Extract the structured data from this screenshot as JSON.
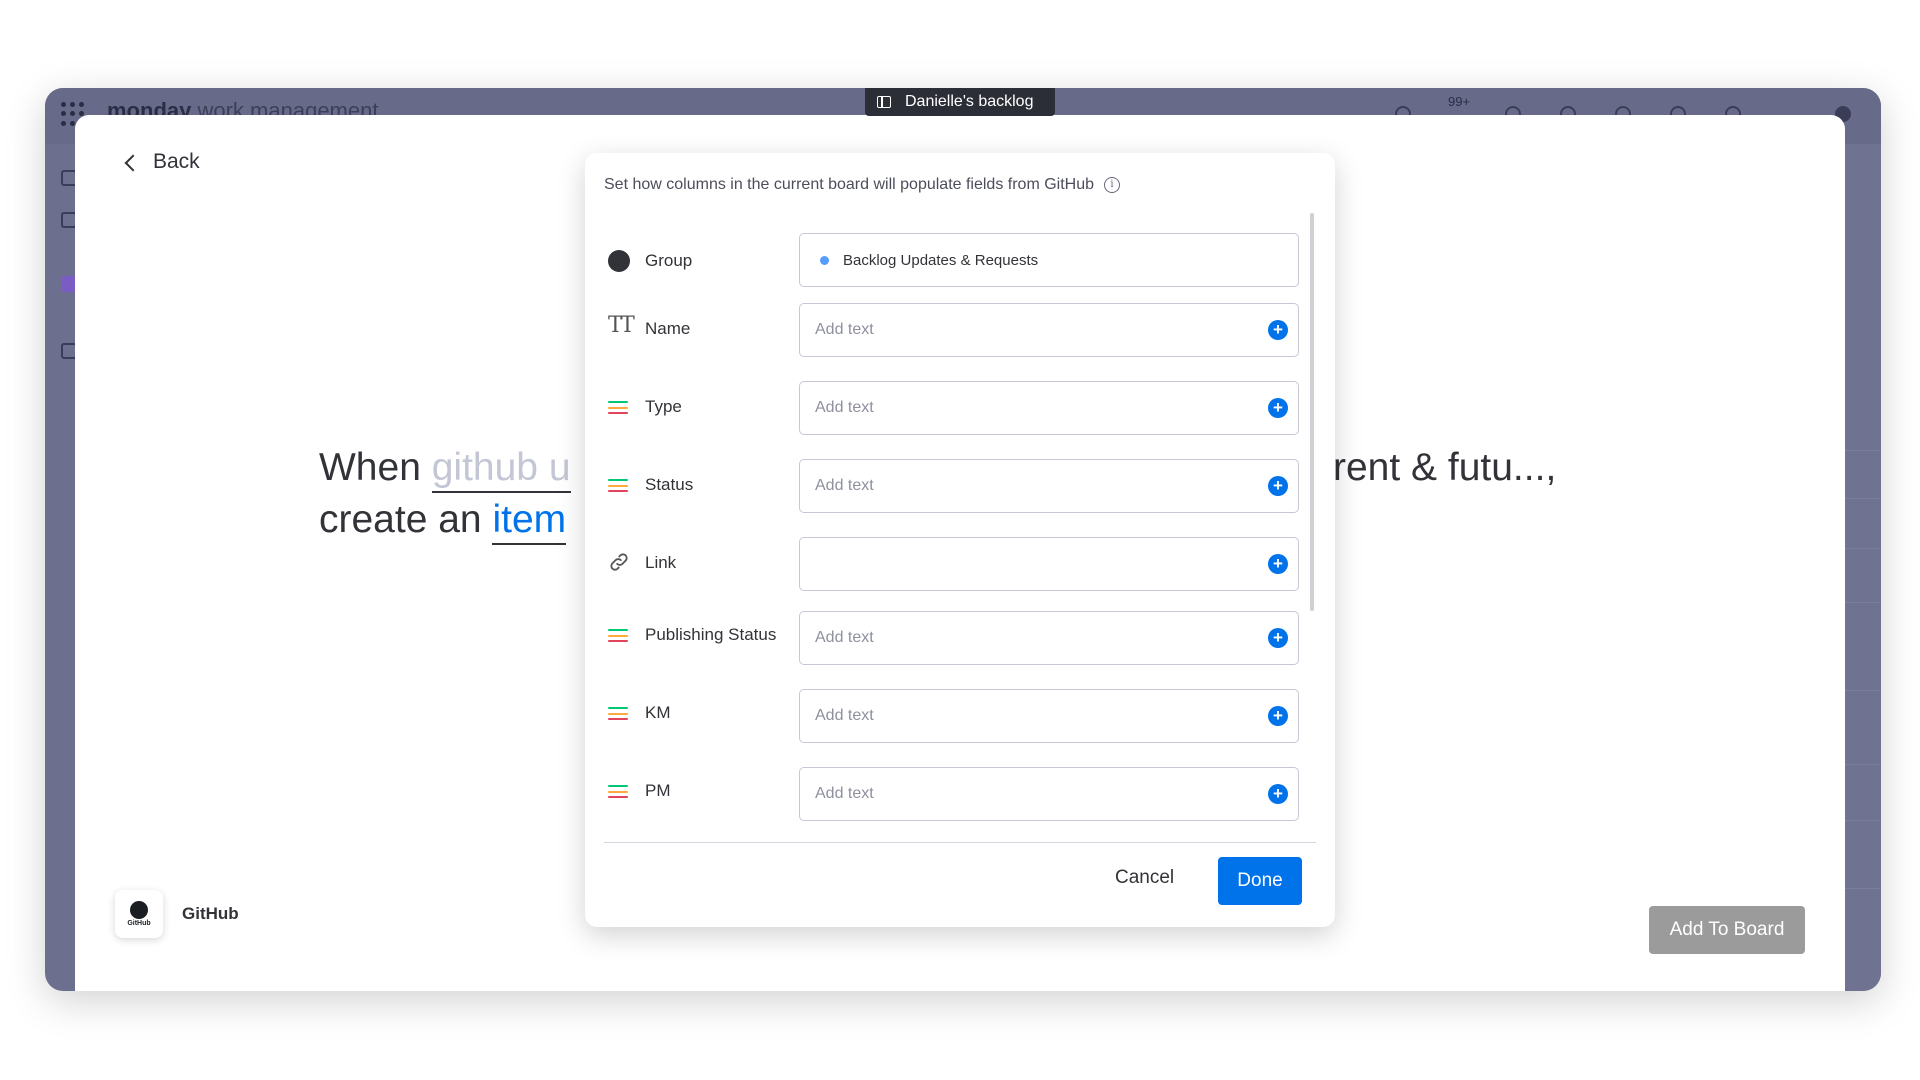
{
  "app": {
    "brand": "monday",
    "brand_suffix": "work management",
    "notification_count": "99+",
    "board_tab": "Danielle's backlog"
  },
  "panel": {
    "back_label": "Back",
    "sentence_start": "When ",
    "sentence_trigger": "github u",
    "sentence_line2_start": "create an ",
    "sentence_item": "item",
    "sentence_right": "rent & futu...",
    "sentence_right_punct": ",",
    "integration_name": "GitHub",
    "logo_text": "GitHub",
    "add_to_board_label": "Add To Board"
  },
  "modal": {
    "description": "Set how columns in the current board will populate fields from GitHub",
    "info_icon": "i",
    "fields": [
      {
        "label": "Group",
        "icon": "circle-icon",
        "value": "Backlog Updates & Requests",
        "placeholder": ""
      },
      {
        "label": "Name",
        "icon": "text-type-icon",
        "value": "",
        "placeholder": "Add text"
      },
      {
        "label": "Type",
        "icon": "status-column-icon",
        "value": "",
        "placeholder": "Add text"
      },
      {
        "label": "Status",
        "icon": "status-column-icon",
        "value": "",
        "placeholder": "Add text"
      },
      {
        "label": "Link",
        "icon": "link-icon",
        "value": "",
        "placeholder": ""
      },
      {
        "label": "Publishing Status",
        "icon": "status-column-icon",
        "value": "",
        "placeholder": "Add text"
      },
      {
        "label": "KM",
        "icon": "status-column-icon",
        "value": "",
        "placeholder": "Add text"
      },
      {
        "label": "PM",
        "icon": "status-column-icon",
        "value": "",
        "placeholder": "Add text"
      }
    ],
    "plus_symbol": "+",
    "cancel_label": "Cancel",
    "done_label": "Done"
  },
  "colors": {
    "accent": "#0073ea",
    "status_lines": [
      "#00c875",
      "#fdab3d",
      "#e2445c"
    ]
  }
}
